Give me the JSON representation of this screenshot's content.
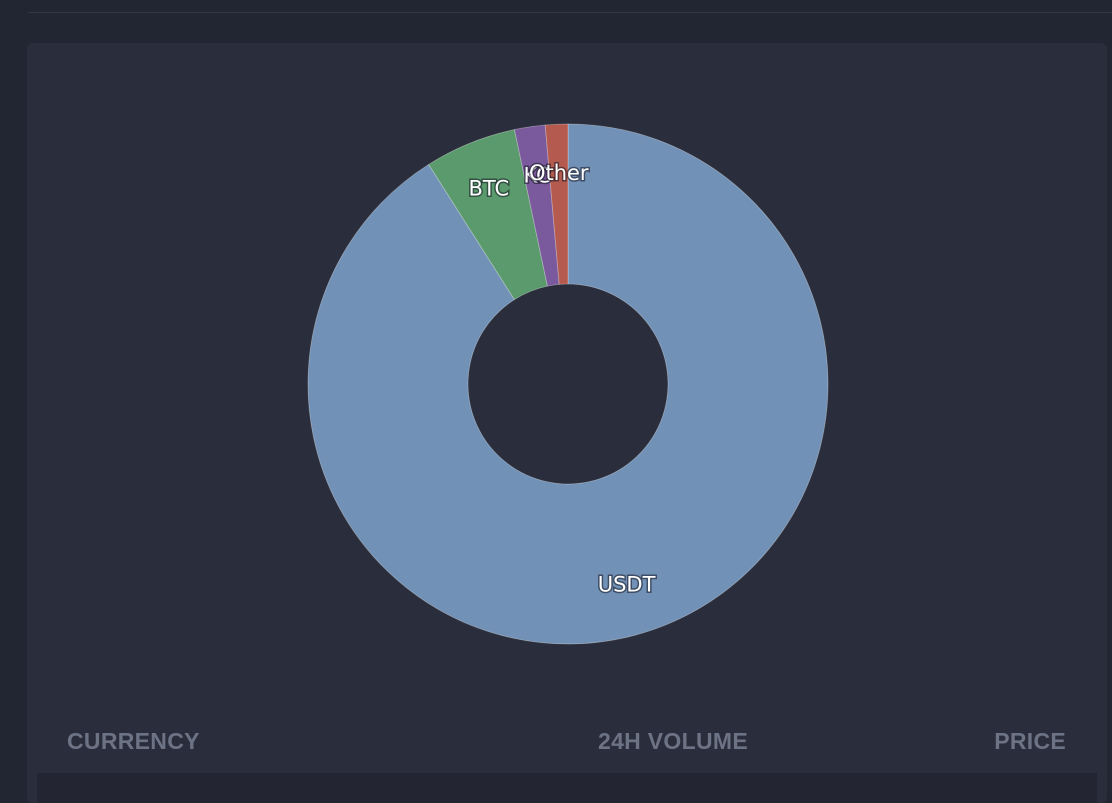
{
  "colors": {
    "usdt": "#7191b6",
    "btc": "#5a9a6c",
    "third": "#7a5a9c",
    "other": "#b55a4e",
    "panel": "#2a2d3b",
    "background": "#222532"
  },
  "chart_data": {
    "type": "pie",
    "donut": true,
    "legend": "none",
    "slices": [
      {
        "label": "USDT",
        "value": 91.0,
        "color_key": "usdt"
      },
      {
        "label": "BTC",
        "value": 5.7,
        "color_key": "btc"
      },
      {
        "label": "KC",
        "value": 1.9,
        "color_key": "third"
      },
      {
        "label": "Other",
        "value": 1.4,
        "color_key": "other"
      }
    ]
  },
  "table": {
    "headers": {
      "currency": "CURRENCY",
      "volume": "24H VOLUME",
      "price": "PRICE"
    }
  }
}
